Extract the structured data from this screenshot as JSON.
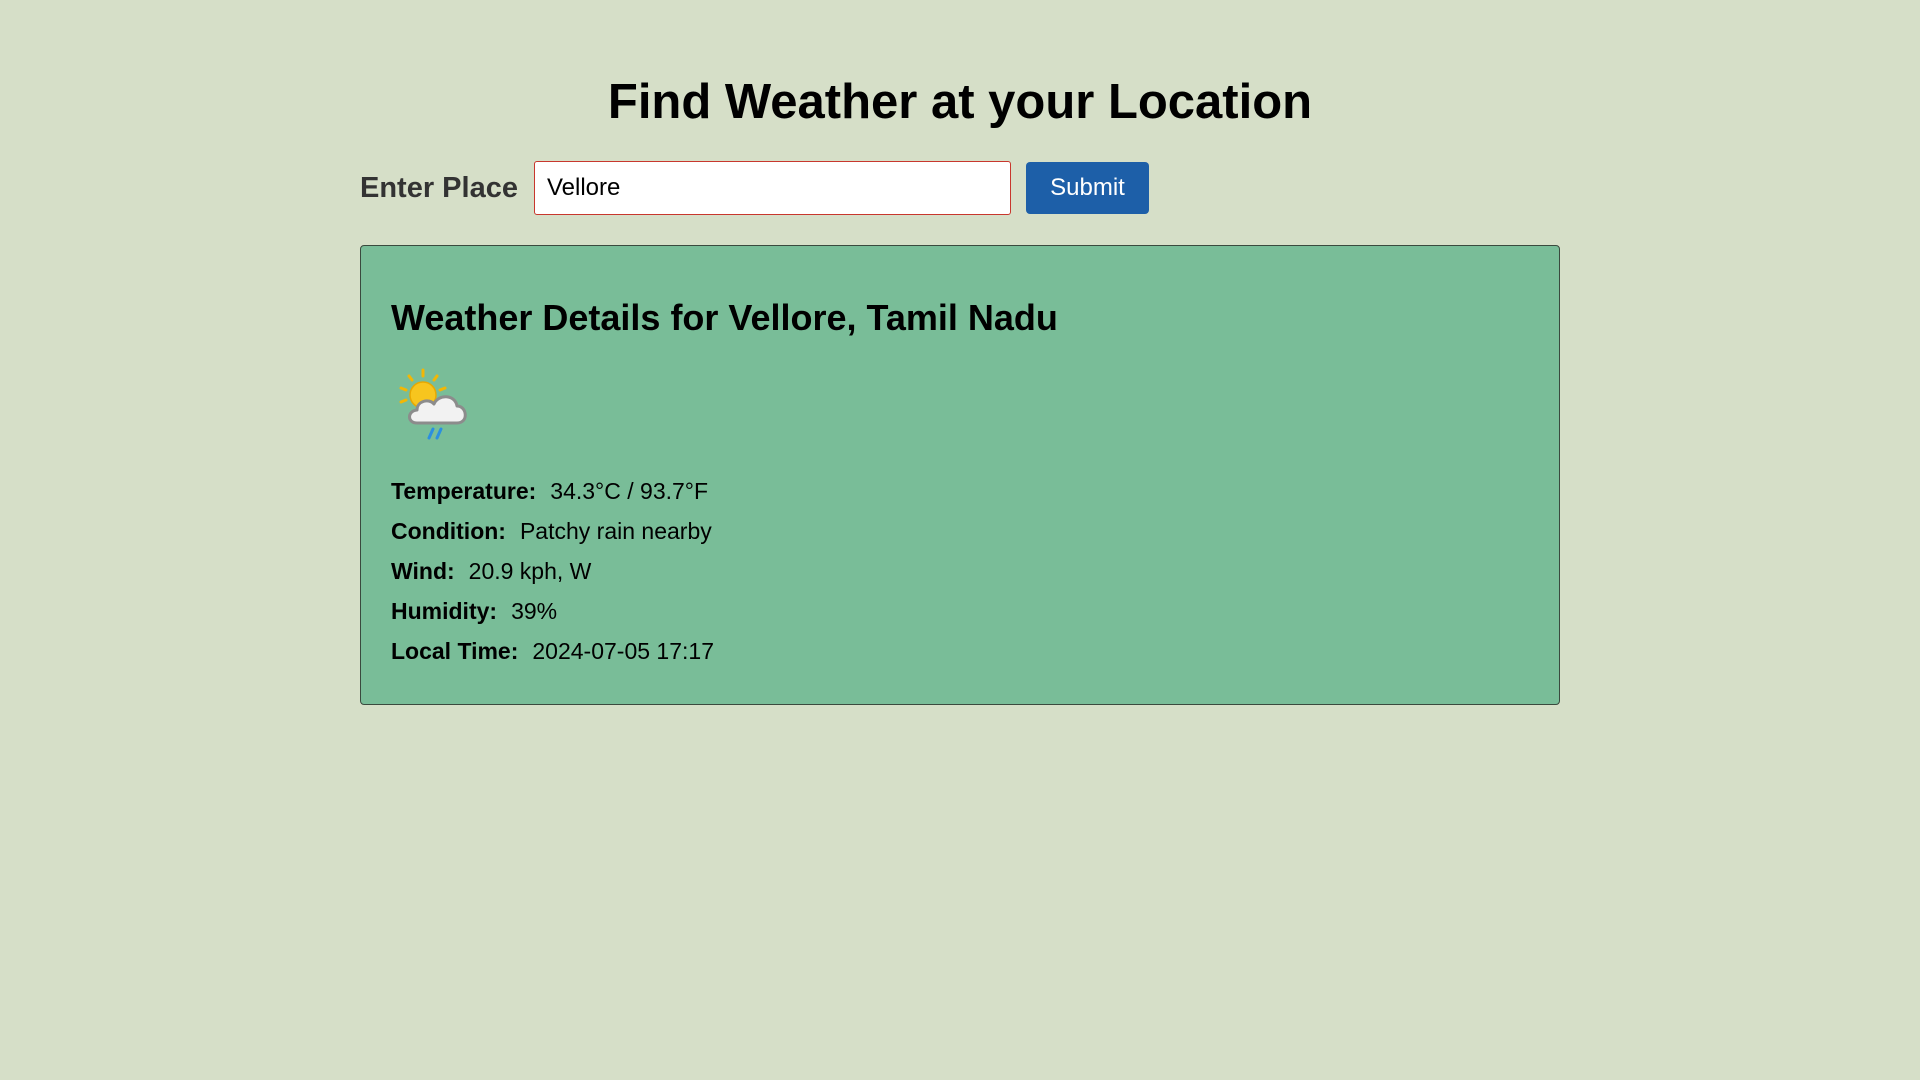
{
  "header": {
    "title": "Find Weather at your Location"
  },
  "search": {
    "label": "Enter Place",
    "value": "Vellore",
    "submit_label": "Submit"
  },
  "weather": {
    "heading": "Weather Details for Vellore, Tamil Nadu",
    "icon": "patchy-rain-icon",
    "details": [
      {
        "label": "Temperature:",
        "value": "34.3°C / 93.7°F"
      },
      {
        "label": "Condition:",
        "value": "Patchy rain nearby"
      },
      {
        "label": "Wind:",
        "value": "20.9 kph, W"
      },
      {
        "label": "Humidity:",
        "value": "39%"
      },
      {
        "label": "Local Time:",
        "value": "2024-07-05 17:17"
      }
    ]
  },
  "colors": {
    "background": "#d6dfc8",
    "card": "#79bd98",
    "button": "#1d5fa8",
    "input_border": "#c8372d"
  }
}
